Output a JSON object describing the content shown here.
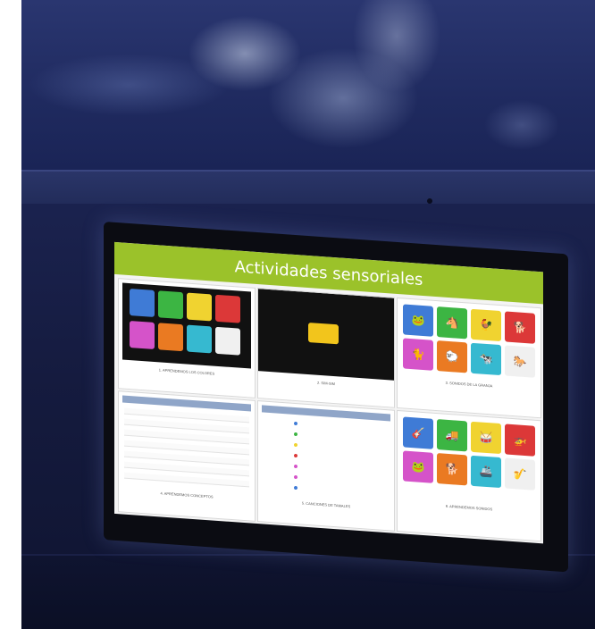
{
  "screen": {
    "title": "Actividades sensoriales",
    "accent_color": "#9bc22a"
  },
  "tiles": [
    {
      "caption": "1. APRENDEMOS LOS COLORES",
      "colors": [
        "#3f7bd6",
        "#3cb543",
        "#f0d330",
        "#dc3838",
        "#d553c9",
        "#ea7a22",
        "#36b9d0",
        "#f0f0f0"
      ]
    },
    {
      "caption": "2. SIM-SIM",
      "box_color": "#f2c51c"
    },
    {
      "caption": "3. SONIDOS DE LA GRANJA",
      "animals": [
        "frog",
        "horse",
        "rooster",
        "dog",
        "cat",
        "sheep",
        "cow",
        "horse"
      ]
    },
    {
      "caption": "4. APRENDEMOS CONCEPTOS"
    },
    {
      "caption": "5. CANCIONES DE TAMALES"
    },
    {
      "caption": "6. APRENDEMOS SONIDOS",
      "items": [
        "guitar",
        "truck",
        "drum",
        "helicopter",
        "frog",
        "dog",
        "boat",
        "saxophone"
      ]
    }
  ]
}
